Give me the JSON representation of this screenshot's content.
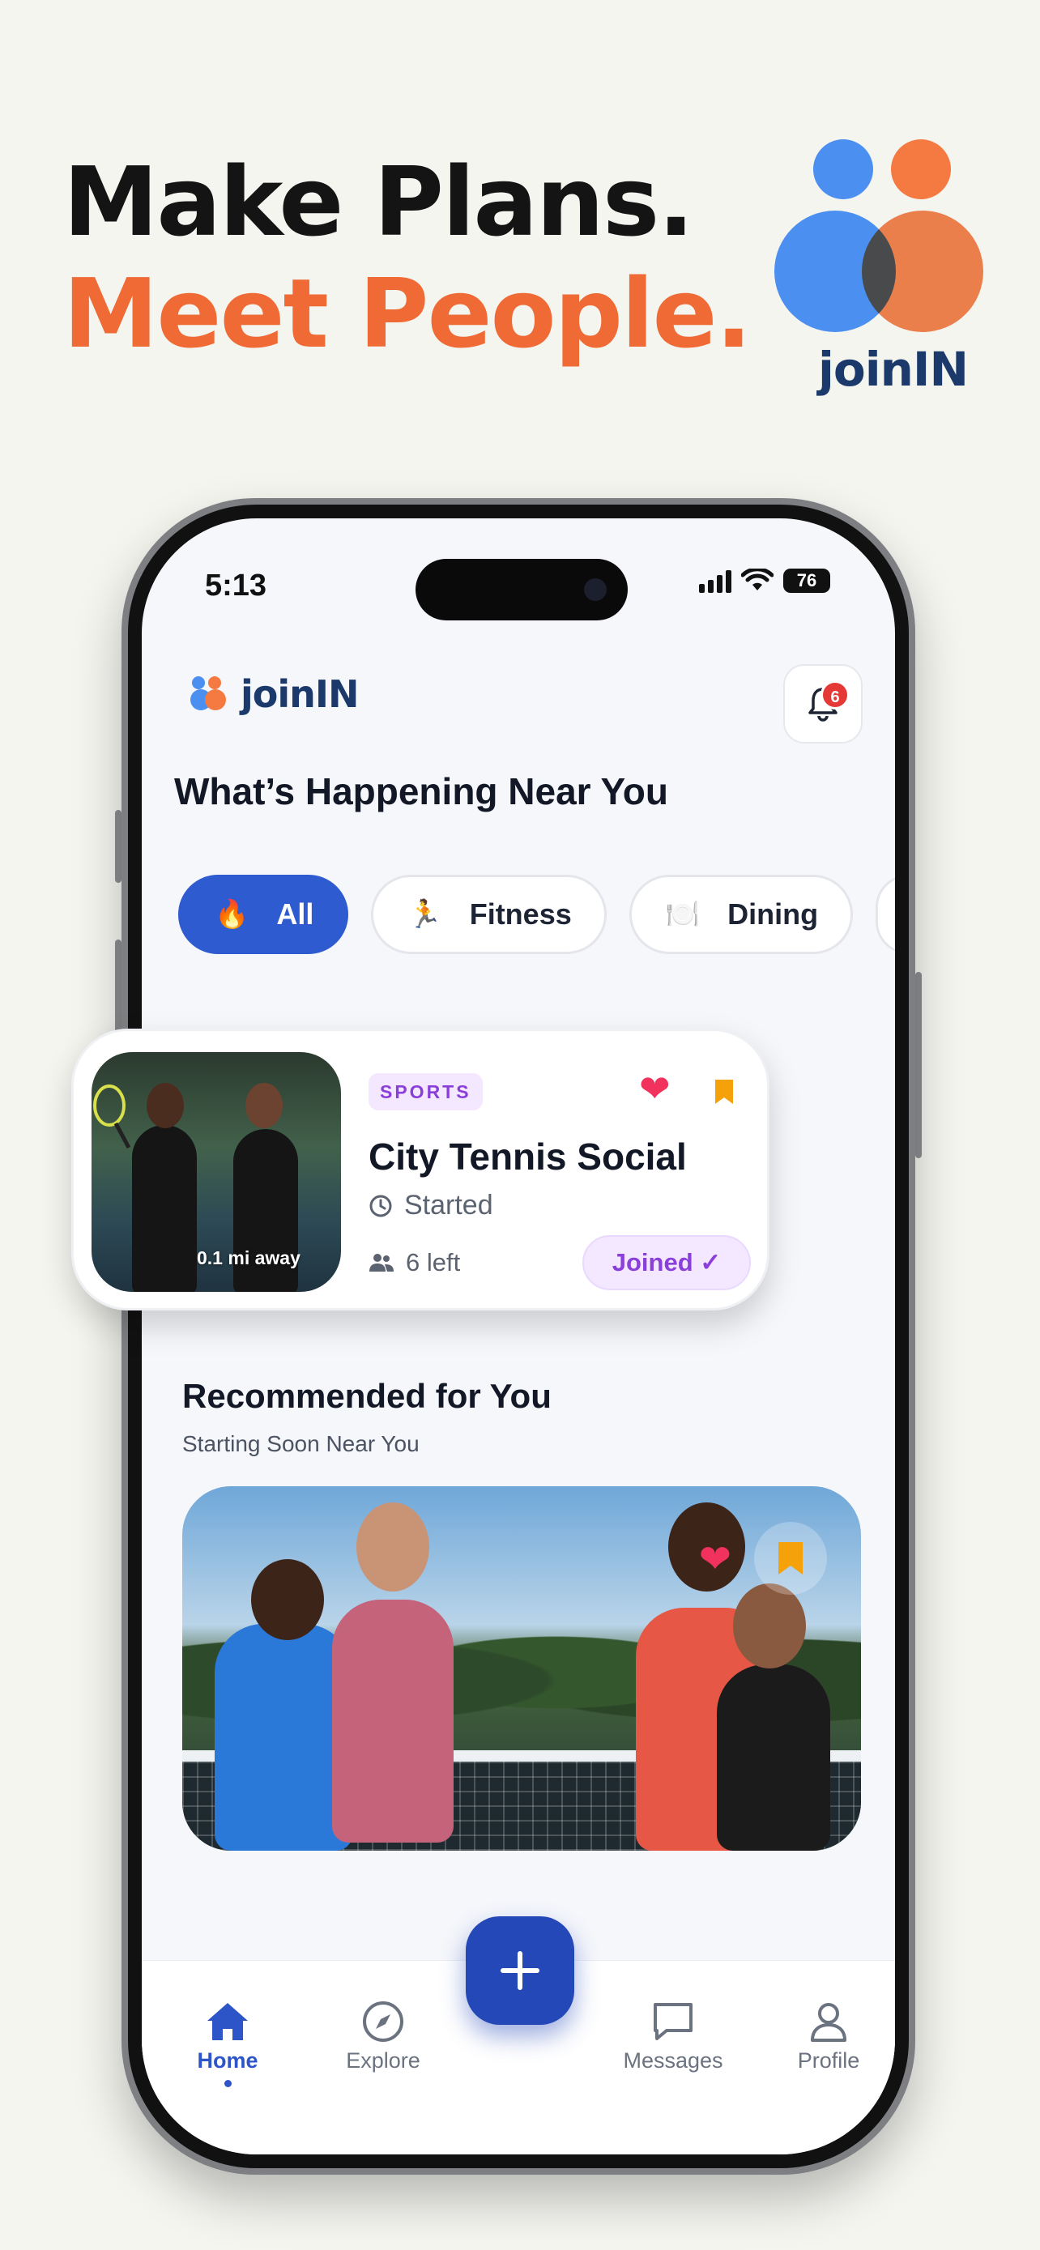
{
  "headline": {
    "line1": "Make Plans.",
    "line2": "Meet People."
  },
  "brand": {
    "wordmark": "joinIN"
  },
  "status_bar": {
    "time": "5:13",
    "battery": "76"
  },
  "app": {
    "logo_text": "joinIN",
    "notification_count": "6",
    "section_title": "What’s Happening Near You"
  },
  "categories": [
    {
      "label": "All",
      "icon": "fire-icon",
      "emoji": "🔥",
      "active": true
    },
    {
      "label": "Fitness",
      "icon": "runner-icon",
      "emoji": "🏃",
      "active": false
    },
    {
      "label": "Dining",
      "icon": "plate-icon",
      "emoji": "🍽️",
      "active": false
    }
  ],
  "event_card": {
    "tag": "SPORTS",
    "title": "City Tennis Social",
    "status": "Started",
    "spots_left": "6 left",
    "distance": "0.1 mi away",
    "joined_label": "Joined ✓"
  },
  "recommended": {
    "title": "Recommended for You",
    "subtitle": "Starting Soon Near You"
  },
  "nav": {
    "home": "Home",
    "explore": "Explore",
    "messages": "Messages",
    "profile": "Profile",
    "fab": "+"
  },
  "colors": {
    "primary": "#2f5bd0",
    "accent_orange": "#f06a35",
    "accent_blue": "#4b8ff0",
    "tag_purple": "#8b3fd9",
    "heart_pink": "#f0325c",
    "bookmark_orange": "#f5a20a"
  }
}
